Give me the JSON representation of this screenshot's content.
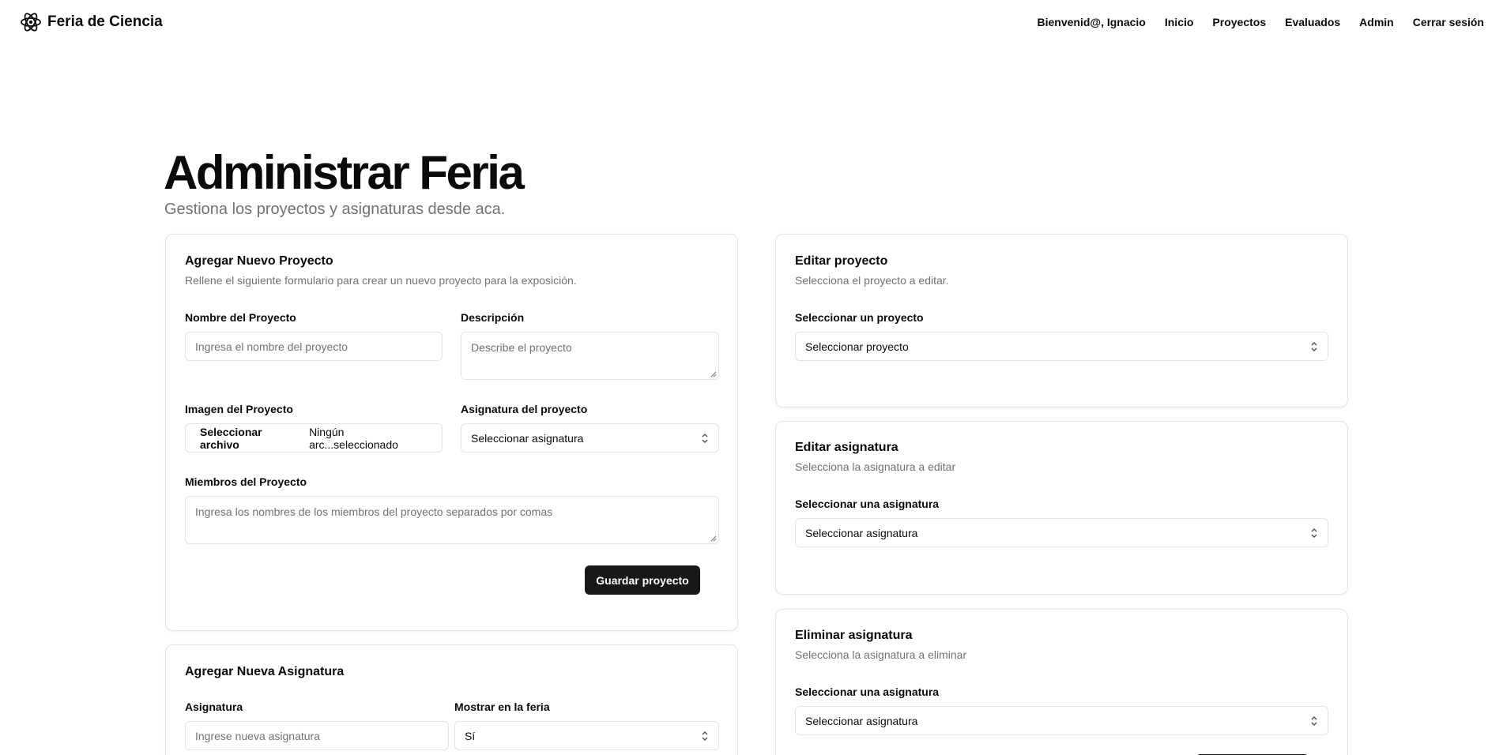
{
  "brand": {
    "name": "Feria de Ciencia",
    "icon": "atom-icon"
  },
  "nav": {
    "welcome": "Bienvenid@, Ignacio",
    "inicio": "Inicio",
    "proyectos": "Proyectos",
    "evaluados": "Evaluados",
    "admin": "Admin",
    "logout": "Cerrar sesión"
  },
  "page": {
    "title": "Administrar Feria",
    "subtitle": "Gestiona los proyectos y asignaturas desde aca."
  },
  "new_project": {
    "title": "Agregar Nuevo Proyecto",
    "description": "Rellene el siguiente formulario para crear un nuevo proyecto para la exposición.",
    "name_label": "Nombre del Proyecto",
    "name_placeholder": "Ingresa el nombre del proyecto",
    "desc_label": "Descripción",
    "desc_placeholder": "Describe el proyecto",
    "image_label": "Imagen del Proyecto",
    "file_button": "Seleccionar archivo",
    "file_status": "Ningún arc...seleccionado",
    "subject_label": "Asignatura del proyecto",
    "subject_value": "Seleccionar asignatura",
    "members_label": "Miembros del Proyecto",
    "members_placeholder": "Ingresa los nombres de los miembros del proyecto separados por comas",
    "save_button": "Guardar proyecto"
  },
  "new_subject": {
    "title": "Agregar Nueva Asignatura",
    "subject_label": "Asignatura",
    "subject_placeholder": "Ingrese nueva asignatura",
    "show_label": "Mostrar en la feria",
    "show_value": "Sí"
  },
  "edit_project": {
    "title": "Editar proyecto",
    "description": "Selecciona el proyecto a editar.",
    "select_label": "Seleccionar un proyecto",
    "select_value": "Seleccionar proyecto"
  },
  "edit_subject": {
    "title": "Editar asignatura",
    "description": "Selecciona la asignatura a editar",
    "select_label": "Seleccionar una asignatura",
    "select_value": "Seleccionar asignatura"
  },
  "delete_subject": {
    "title": "Eliminar asignatura",
    "description": "Selecciona la asignatura a eliminar",
    "select_label": "Seleccionar una asignatura",
    "select_value": "Seleccionar asignatura"
  }
}
